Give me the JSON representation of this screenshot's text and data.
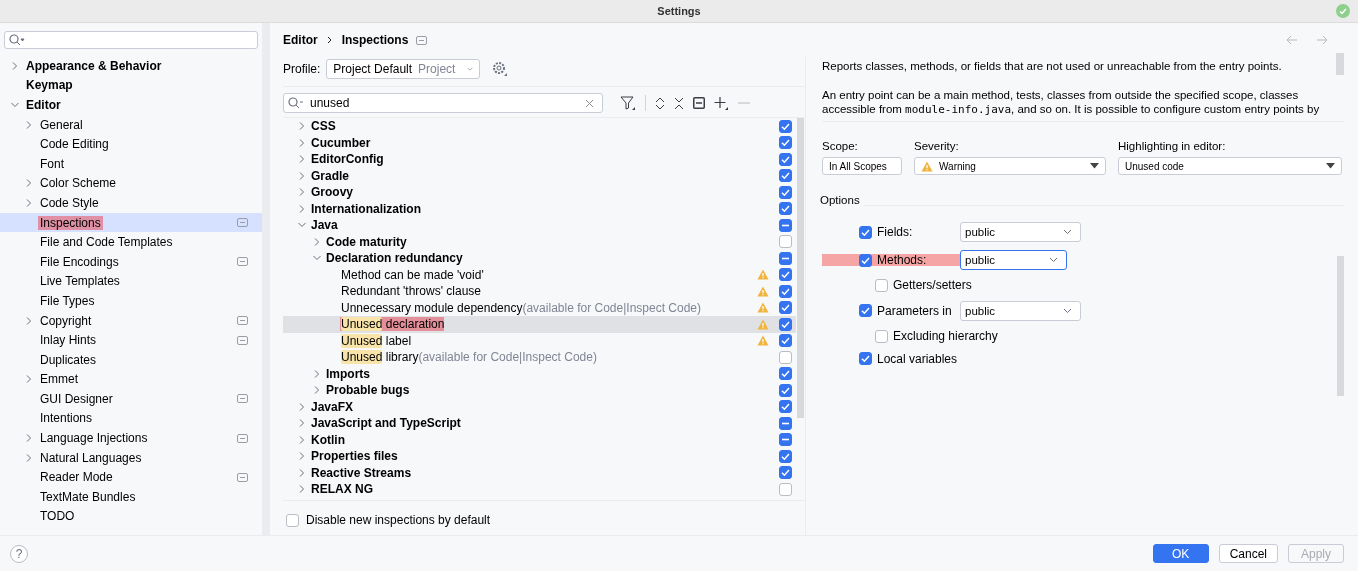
{
  "window": {
    "title": "Settings"
  },
  "sidebar": {
    "items": [
      {
        "label": "Appearance & Behavior",
        "expandable": true,
        "expanded": false,
        "selected": false,
        "annotated": false,
        "project_icon": false
      },
      {
        "label": "Keymap",
        "expandable": false,
        "selected": false,
        "annotated": false,
        "project_icon": false
      },
      {
        "label": "Editor",
        "expandable": true,
        "expanded": true,
        "selected": false,
        "annotated": false,
        "project_icon": false,
        "children": [
          {
            "label": "General",
            "expandable": true,
            "expanded": false,
            "selected": false,
            "annotated": false,
            "project_icon": false
          },
          {
            "label": "Code Editing",
            "expandable": false,
            "selected": false,
            "annotated": false,
            "project_icon": false
          },
          {
            "label": "Font",
            "expandable": false,
            "selected": false,
            "annotated": false,
            "project_icon": false
          },
          {
            "label": "Color Scheme",
            "expandable": true,
            "expanded": false,
            "selected": false,
            "annotated": false,
            "project_icon": false
          },
          {
            "label": "Code Style",
            "expandable": true,
            "expanded": false,
            "selected": false,
            "annotated": false,
            "project_icon": false
          },
          {
            "label": "Inspections",
            "expandable": false,
            "selected": true,
            "annotated": true,
            "project_icon": true
          },
          {
            "label": "File and Code Templates",
            "expandable": false,
            "selected": false,
            "annotated": false,
            "project_icon": false
          },
          {
            "label": "File Encodings",
            "expandable": false,
            "selected": false,
            "annotated": false,
            "project_icon": true
          },
          {
            "label": "Live Templates",
            "expandable": false,
            "selected": false,
            "annotated": false,
            "project_icon": false
          },
          {
            "label": "File Types",
            "expandable": false,
            "selected": false,
            "annotated": false,
            "project_icon": false
          },
          {
            "label": "Copyright",
            "expandable": true,
            "expanded": false,
            "selected": false,
            "annotated": false,
            "project_icon": true
          },
          {
            "label": "Inlay Hints",
            "expandable": false,
            "selected": false,
            "annotated": false,
            "project_icon": true
          },
          {
            "label": "Duplicates",
            "expandable": false,
            "selected": false,
            "annotated": false,
            "project_icon": false
          },
          {
            "label": "Emmet",
            "expandable": true,
            "expanded": false,
            "selected": false,
            "annotated": false,
            "project_icon": false
          },
          {
            "label": "GUI Designer",
            "expandable": false,
            "selected": false,
            "annotated": false,
            "project_icon": true
          },
          {
            "label": "Intentions",
            "expandable": false,
            "selected": false,
            "annotated": false,
            "project_icon": false
          },
          {
            "label": "Language Injections",
            "expandable": true,
            "expanded": false,
            "selected": false,
            "annotated": false,
            "project_icon": true
          },
          {
            "label": "Natural Languages",
            "expandable": true,
            "expanded": false,
            "selected": false,
            "annotated": false,
            "project_icon": false
          },
          {
            "label": "Reader Mode",
            "expandable": false,
            "selected": false,
            "annotated": false,
            "project_icon": true
          },
          {
            "label": "TextMate Bundles",
            "expandable": false,
            "selected": false,
            "annotated": false,
            "project_icon": false
          },
          {
            "label": "TODO",
            "expandable": false,
            "selected": false,
            "annotated": false,
            "project_icon": false
          }
        ]
      }
    ]
  },
  "breadcrumb": [
    "Editor",
    "Inspections"
  ],
  "profile": {
    "label": "Profile:",
    "value": "Project Default",
    "scope": "Project"
  },
  "filter": {
    "value": "unused"
  },
  "inspections": [
    {
      "text": "CSS",
      "expandable": true,
      "expanded": false,
      "checked": true,
      "partial": false,
      "warning": false,
      "selected": false,
      "annotated": false
    },
    {
      "text": "Cucumber",
      "expandable": true,
      "expanded": false,
      "checked": true,
      "partial": false,
      "warning": false,
      "selected": false,
      "annotated": false
    },
    {
      "text": "EditorConfig",
      "expandable": true,
      "expanded": false,
      "checked": true,
      "partial": false,
      "warning": false,
      "selected": false,
      "annotated": false
    },
    {
      "text": "Gradle",
      "expandable": true,
      "expanded": false,
      "checked": true,
      "partial": false,
      "warning": false,
      "selected": false,
      "annotated": false
    },
    {
      "text": "Groovy",
      "expandable": true,
      "expanded": false,
      "checked": true,
      "partial": false,
      "warning": false,
      "selected": false,
      "annotated": false
    },
    {
      "text": "Internationalization",
      "expandable": true,
      "expanded": false,
      "checked": true,
      "partial": false,
      "warning": false,
      "selected": false,
      "annotated": false
    },
    {
      "text": "Java",
      "expandable": true,
      "expanded": true,
      "partial": true,
      "warning": false,
      "selected": false,
      "annotated": false,
      "children": [
        {
          "text": "Code maturity",
          "expandable": true,
          "expanded": false,
          "checked": false,
          "partial": false,
          "warning": false,
          "selected": false,
          "annotated": false
        },
        {
          "text": "Declaration redundancy",
          "expandable": true,
          "expanded": true,
          "partial": true,
          "warning": false,
          "selected": false,
          "annotated": false,
          "children": [
            {
              "text": "Method can be made 'void'",
              "expandable": false,
              "checked": true,
              "partial": false,
              "warning": true,
              "selected": false,
              "annotated": false
            },
            {
              "text": "Redundant 'throws' clause",
              "expandable": false,
              "checked": true,
              "partial": false,
              "warning": true,
              "selected": false,
              "annotated": false
            },
            {
              "text": "Unnecessary module dependency",
              "note": "(available for Code|Inspect Code)",
              "expandable": false,
              "checked": true,
              "partial": false,
              "warning": true,
              "selected": false,
              "annotated": false
            },
            {
              "match": "Unused",
              "text": " declaration",
              "expandable": false,
              "checked": true,
              "partial": false,
              "warning": true,
              "selected": true,
              "annotated": true
            },
            {
              "match": "Unused",
              "text": " label",
              "expandable": false,
              "checked": true,
              "partial": false,
              "warning": true,
              "selected": false,
              "annotated": false
            },
            {
              "match": "Unused",
              "text": " library",
              "note": "(available for Code|Inspect Code)",
              "expandable": false,
              "checked": false,
              "partial": false,
              "warning": false,
              "selected": false,
              "annotated": false
            }
          ]
        },
        {
          "text": "Imports",
          "expandable": true,
          "expanded": false,
          "checked": true,
          "partial": false,
          "warning": false,
          "selected": false,
          "annotated": false
        },
        {
          "text": "Probable bugs",
          "expandable": true,
          "expanded": false,
          "checked": true,
          "partial": false,
          "warning": false,
          "selected": false,
          "annotated": false
        }
      ]
    },
    {
      "text": "JavaFX",
      "expandable": true,
      "expanded": false,
      "checked": true,
      "partial": false,
      "warning": false,
      "selected": false,
      "annotated": false
    },
    {
      "text": "JavaScript and TypeScript",
      "expandable": true,
      "expanded": false,
      "partial": true,
      "warning": false,
      "selected": false,
      "annotated": false
    },
    {
      "text": "Kotlin",
      "expandable": true,
      "expanded": false,
      "partial": true,
      "warning": false,
      "selected": false,
      "annotated": false
    },
    {
      "text": "Properties files",
      "expandable": true,
      "expanded": false,
      "checked": true,
      "partial": false,
      "warning": false,
      "selected": false,
      "annotated": false
    },
    {
      "text": "Reactive Streams",
      "expandable": true,
      "expanded": false,
      "checked": true,
      "partial": false,
      "warning": false,
      "selected": false,
      "annotated": false
    },
    {
      "text": "RELAX NG",
      "expandable": true,
      "expanded": false,
      "checked": false,
      "partial": false,
      "warning": false,
      "selected": false,
      "annotated": false
    }
  ],
  "disable_new": {
    "label": "Disable new inspections by default",
    "checked": false
  },
  "description": {
    "paragraph_1": "Reports classes, methods, or fields that are not used or unreachable from the entry points.",
    "paragraph_2": {
      "before": "An entry point can be a main method, tests, classes from outside the specified scope, classes accessible from ",
      "code": "module-info.java",
      "after": ", and so on. It is possible to configure custom entry points by"
    }
  },
  "scope": {
    "label": "Scope:",
    "value": "In All Scopes"
  },
  "severity": {
    "label": "Severity:",
    "value": "Warning"
  },
  "highlighting": {
    "label": "Highlighting in editor:",
    "value": "Unused code"
  },
  "options": {
    "title": "Options",
    "items": [
      {
        "label": "Fields:",
        "checked": true,
        "select": "public",
        "focused": false,
        "annotated": false
      },
      {
        "label": "Methods:",
        "checked": true,
        "select": "public",
        "focused": true,
        "annotated": true,
        "children": [
          {
            "label": "Getters/setters",
            "checked": false,
            "annotated": false
          }
        ]
      },
      {
        "label": "Parameters in",
        "checked": true,
        "select": "public",
        "focused": false,
        "annotated": false,
        "children": [
          {
            "label": "Excluding hierarchy",
            "checked": false,
            "annotated": false
          }
        ]
      },
      {
        "label": "Local variables",
        "checked": true,
        "annotated": false
      }
    ]
  },
  "help": "?",
  "buttons": [
    {
      "label": "OK",
      "kind": "primary",
      "disabled": false
    },
    {
      "label": "Cancel",
      "kind": "default",
      "disabled": false
    },
    {
      "label": "Apply",
      "kind": "default",
      "disabled": true
    }
  ]
}
